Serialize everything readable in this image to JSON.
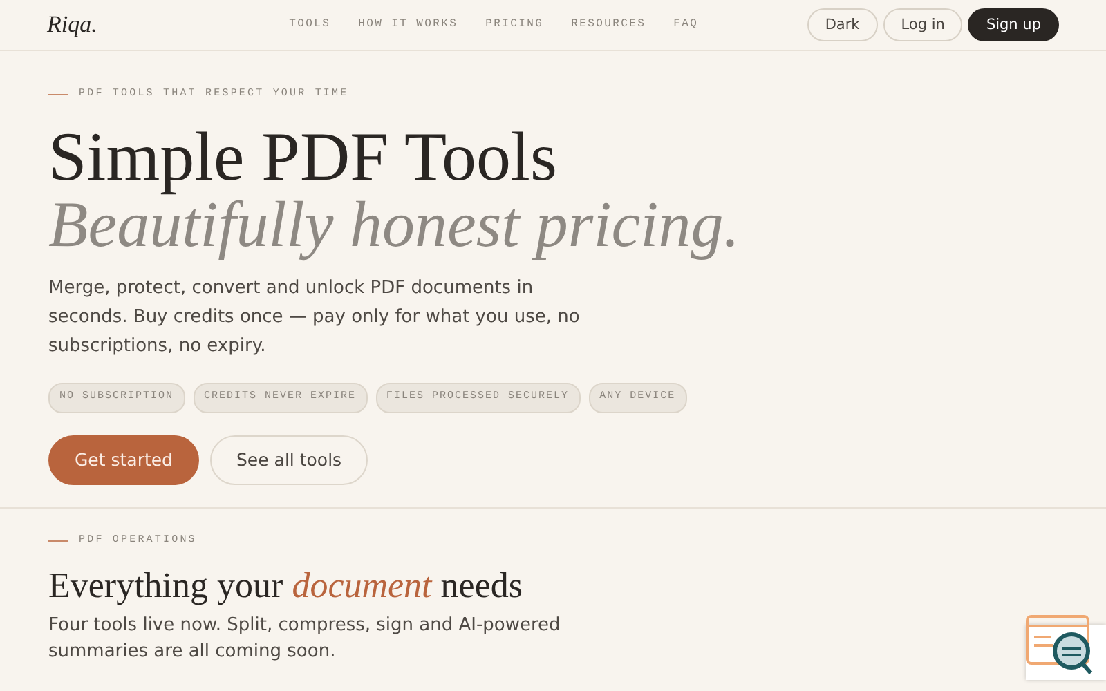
{
  "brand": "Riqa.",
  "nav": [
    "TOOLS",
    "HOW IT WORKS",
    "PRICING",
    "RESOURCES",
    "FAQ"
  ],
  "actions": [
    {
      "label": "Dark",
      "kind": "outline"
    },
    {
      "label": "Log in",
      "kind": "outline"
    },
    {
      "label": "Sign up",
      "kind": "dark"
    }
  ],
  "hero": {
    "eyebrow": "PDF TOOLS THAT RESPECT YOUR TIME",
    "title": "Simple PDF Tools",
    "subtitle": "Beautifully honest pricing.",
    "description": "Merge, protect, convert and unlock PDF documents in seconds. Buy credits once — pay only for what you use, no subscriptions, no expiry.",
    "tags": [
      "NO SUBSCRIPTION",
      "CREDITS NEVER EXPIRE",
      "FILES PROCESSED SECURELY",
      "ANY DEVICE"
    ],
    "buttons": [
      {
        "label": "Get started",
        "kind": "primary"
      },
      {
        "label": "See all tools",
        "kind": "outline"
      }
    ]
  },
  "section": {
    "eyebrow": "PDF OPERATIONS",
    "title": "Everything your *document* needs",
    "description": "Four tools live now. Split, compress, sign and AI-powered summaries are all coming soon."
  }
}
